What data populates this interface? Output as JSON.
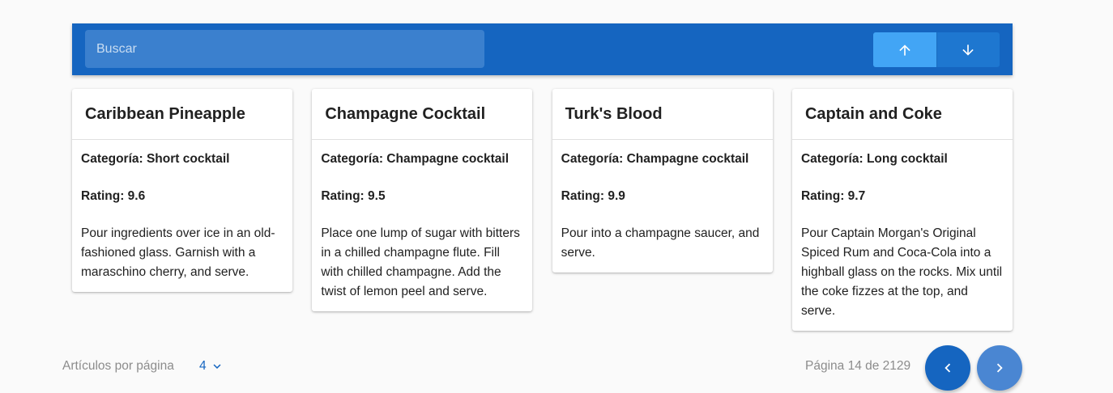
{
  "toolbar": {
    "search_placeholder": "Buscar",
    "search_value": "",
    "sort_asc_icon": "arrow-up-icon",
    "sort_desc_icon": "arrow-down-icon",
    "colors": {
      "bar": "#1565c0",
      "search": "#3b80ce",
      "asc": "#42a5f5",
      "desc": "#1e77d0"
    }
  },
  "cards": [
    {
      "title": "Caribbean Pineapple",
      "category": "Categoría: Short cocktail",
      "rating": "Rating: 9.6",
      "description": "Pour ingredients over ice in an old-fashioned glass. Garnish with a maraschino cherry, and serve."
    },
    {
      "title": "Champagne Cocktail",
      "category": "Categoría: Champagne cocktail",
      "rating": "Rating: 9.5",
      "description": "Place one lump of sugar with bitters in a chilled champagne flute. Fill with chilled champagne. Add the twist of lemon peel and serve."
    },
    {
      "title": "Turk's Blood",
      "category": "Categoría: Champagne cocktail",
      "rating": "Rating: 9.9",
      "description": "Pour into a champagne saucer, and serve."
    },
    {
      "title": "Captain and Coke",
      "category": "Categoría: Long cocktail",
      "rating": "Rating: 9.7",
      "description": "Pour Captain Morgan's Original Spiced Rum and Coca-Cola into a highball glass on the rocks. Mix until the coke fizzes at the top, and serve."
    }
  ],
  "pagination": {
    "items_per_page_label": "Artículos por página",
    "items_per_page_value": "4",
    "page_info": "Página 14 de 2129",
    "prev_icon": "chevron-left-icon",
    "next_icon": "chevron-right-icon"
  }
}
